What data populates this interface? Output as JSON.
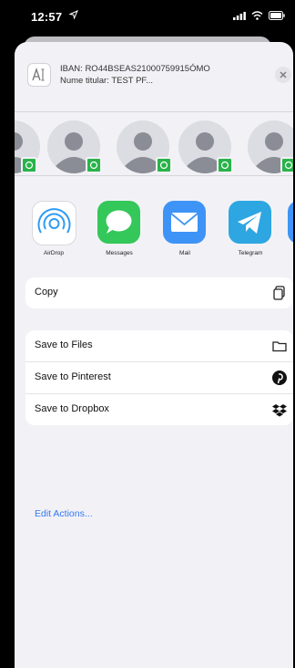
{
  "status_bar": {
    "time": "12:57",
    "icons": [
      "location-arrow-icon",
      "cellular-signal-icon",
      "wifi-icon",
      "battery-icon"
    ]
  },
  "share_header": {
    "iban_line": "IBAN: RO44BSEAS21000759915ÓMO",
    "holder_line": "Nume titular: TEST PF..."
  },
  "contacts": [
    {
      "avatar": "person-placeholder",
      "badge": "whatsapp-icon"
    },
    {
      "avatar": "person-placeholder",
      "badge": "whatsapp-icon"
    },
    {
      "avatar": "person-placeholder",
      "badge": "whatsapp-icon"
    },
    {
      "avatar": "person-placeholder",
      "badge": "whatsapp-icon"
    },
    {
      "avatar": "person-placeholder",
      "badge": "whatsapp-icon"
    }
  ],
  "apps": [
    {
      "label": "AirDrop",
      "icon": "airdrop-icon",
      "color": "#2f9bf3"
    },
    {
      "label": "Messages",
      "icon": "messages-icon",
      "color": "#34c759"
    },
    {
      "label": "Mail",
      "icon": "mail-icon",
      "color": "#3e94f6"
    },
    {
      "label": "Telegram",
      "icon": "telegram-icon",
      "color": "#2ea6e2"
    }
  ],
  "actions": {
    "copy": {
      "label": "Copy",
      "icon": "copy-icon"
    },
    "save_to_files": {
      "label": "Save to Files",
      "icon": "folder-icon"
    },
    "save_to_pinterest": {
      "label": "Save to Pinterest",
      "icon": "pinterest-icon"
    },
    "save_to_dropbox": {
      "label": "Save to Dropbox",
      "icon": "dropbox-icon"
    }
  },
  "edit_actions": "Edit Actions..."
}
